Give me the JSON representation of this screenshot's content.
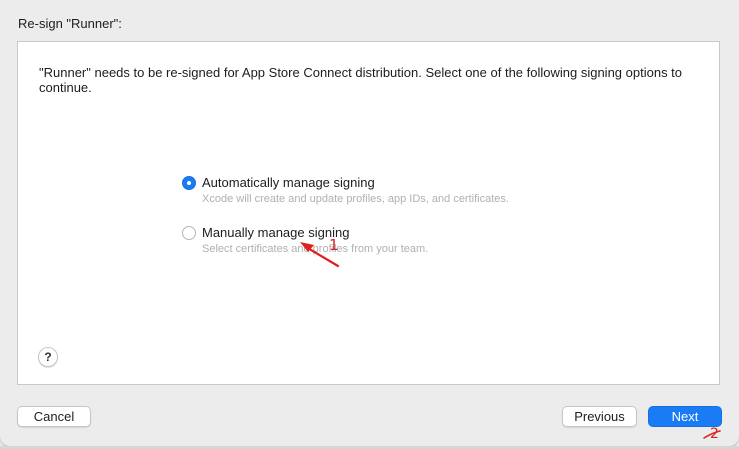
{
  "dialog": {
    "title": "Re-sign \"Runner\":",
    "description": "\"Runner\" needs to be re-signed for App Store Connect distribution. Select one of the following signing options to continue."
  },
  "options": [
    {
      "label": "Automatically manage signing",
      "description": "Xcode will create and update profiles, app IDs, and certificates.",
      "selected": true
    },
    {
      "label": "Manually manage signing",
      "description": "Select certificates and profiles from your team.",
      "selected": false
    }
  ],
  "help": {
    "label": "?"
  },
  "buttons": {
    "cancel": "Cancel",
    "previous": "Previous",
    "next": "Next"
  },
  "annotations": {
    "marker_1": "1",
    "marker_2": "2",
    "color": "#e02020"
  },
  "colors": {
    "accent": "#1a7cf5",
    "background": "#ececec",
    "panel": "#ffffff"
  }
}
